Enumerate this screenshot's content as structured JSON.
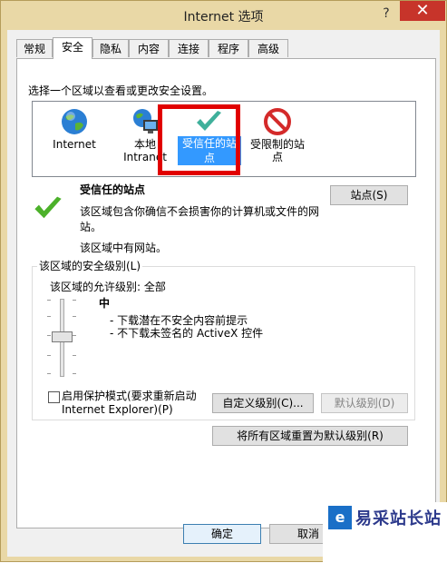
{
  "window": {
    "title": "Internet 选项",
    "help": "?",
    "close": "✕"
  },
  "tabs": [
    "常规",
    "安全",
    "隐私",
    "内容",
    "连接",
    "程序",
    "高级"
  ],
  "zones_prompt": "选择一个区域以查看或更改安全设置。",
  "zones": [
    {
      "label": "Internet",
      "icon": "globe-icon"
    },
    {
      "label": "本地\nIntranet",
      "icon": "local-intranet-icon"
    },
    {
      "label": "受信任的站点",
      "icon": "trusted-check-icon",
      "selected": true
    },
    {
      "label": "受限制的站点",
      "icon": "restricted-icon"
    }
  ],
  "selected_zone": {
    "name": "受信任的站点",
    "description": "该区域包含你确信不会损害你的计算机或文件的网站。",
    "sites_note": "该区域中有网站。",
    "sites_button": "站点(S)"
  },
  "security_level": {
    "group_label": "该区域的安全级别(L)",
    "allowed_levels": "该区域的允许级别: 全部",
    "level": "中",
    "bullets": [
      "- 下载潜在不安全内容前提示",
      "- 不下载未签名的 ActiveX 控件"
    ],
    "protected_mode_label": "启用保护模式(要求重新启动\nInternet Explorer)(P)",
    "custom_level_button": "自定义级别(C)...",
    "default_level_button": "默认级别(D)",
    "reset_all_button": "将所有区域重置为默认级别(R)"
  },
  "footer": {
    "ok": "确定",
    "cancel": "取消"
  },
  "watermark": {
    "text": "易采站长站",
    "logo_glyph": "e"
  },
  "colors": {
    "title_bg": "#e9d8a6",
    "close_bg": "#c7342a",
    "highlight": "#e10000",
    "select": "#3399ff"
  }
}
